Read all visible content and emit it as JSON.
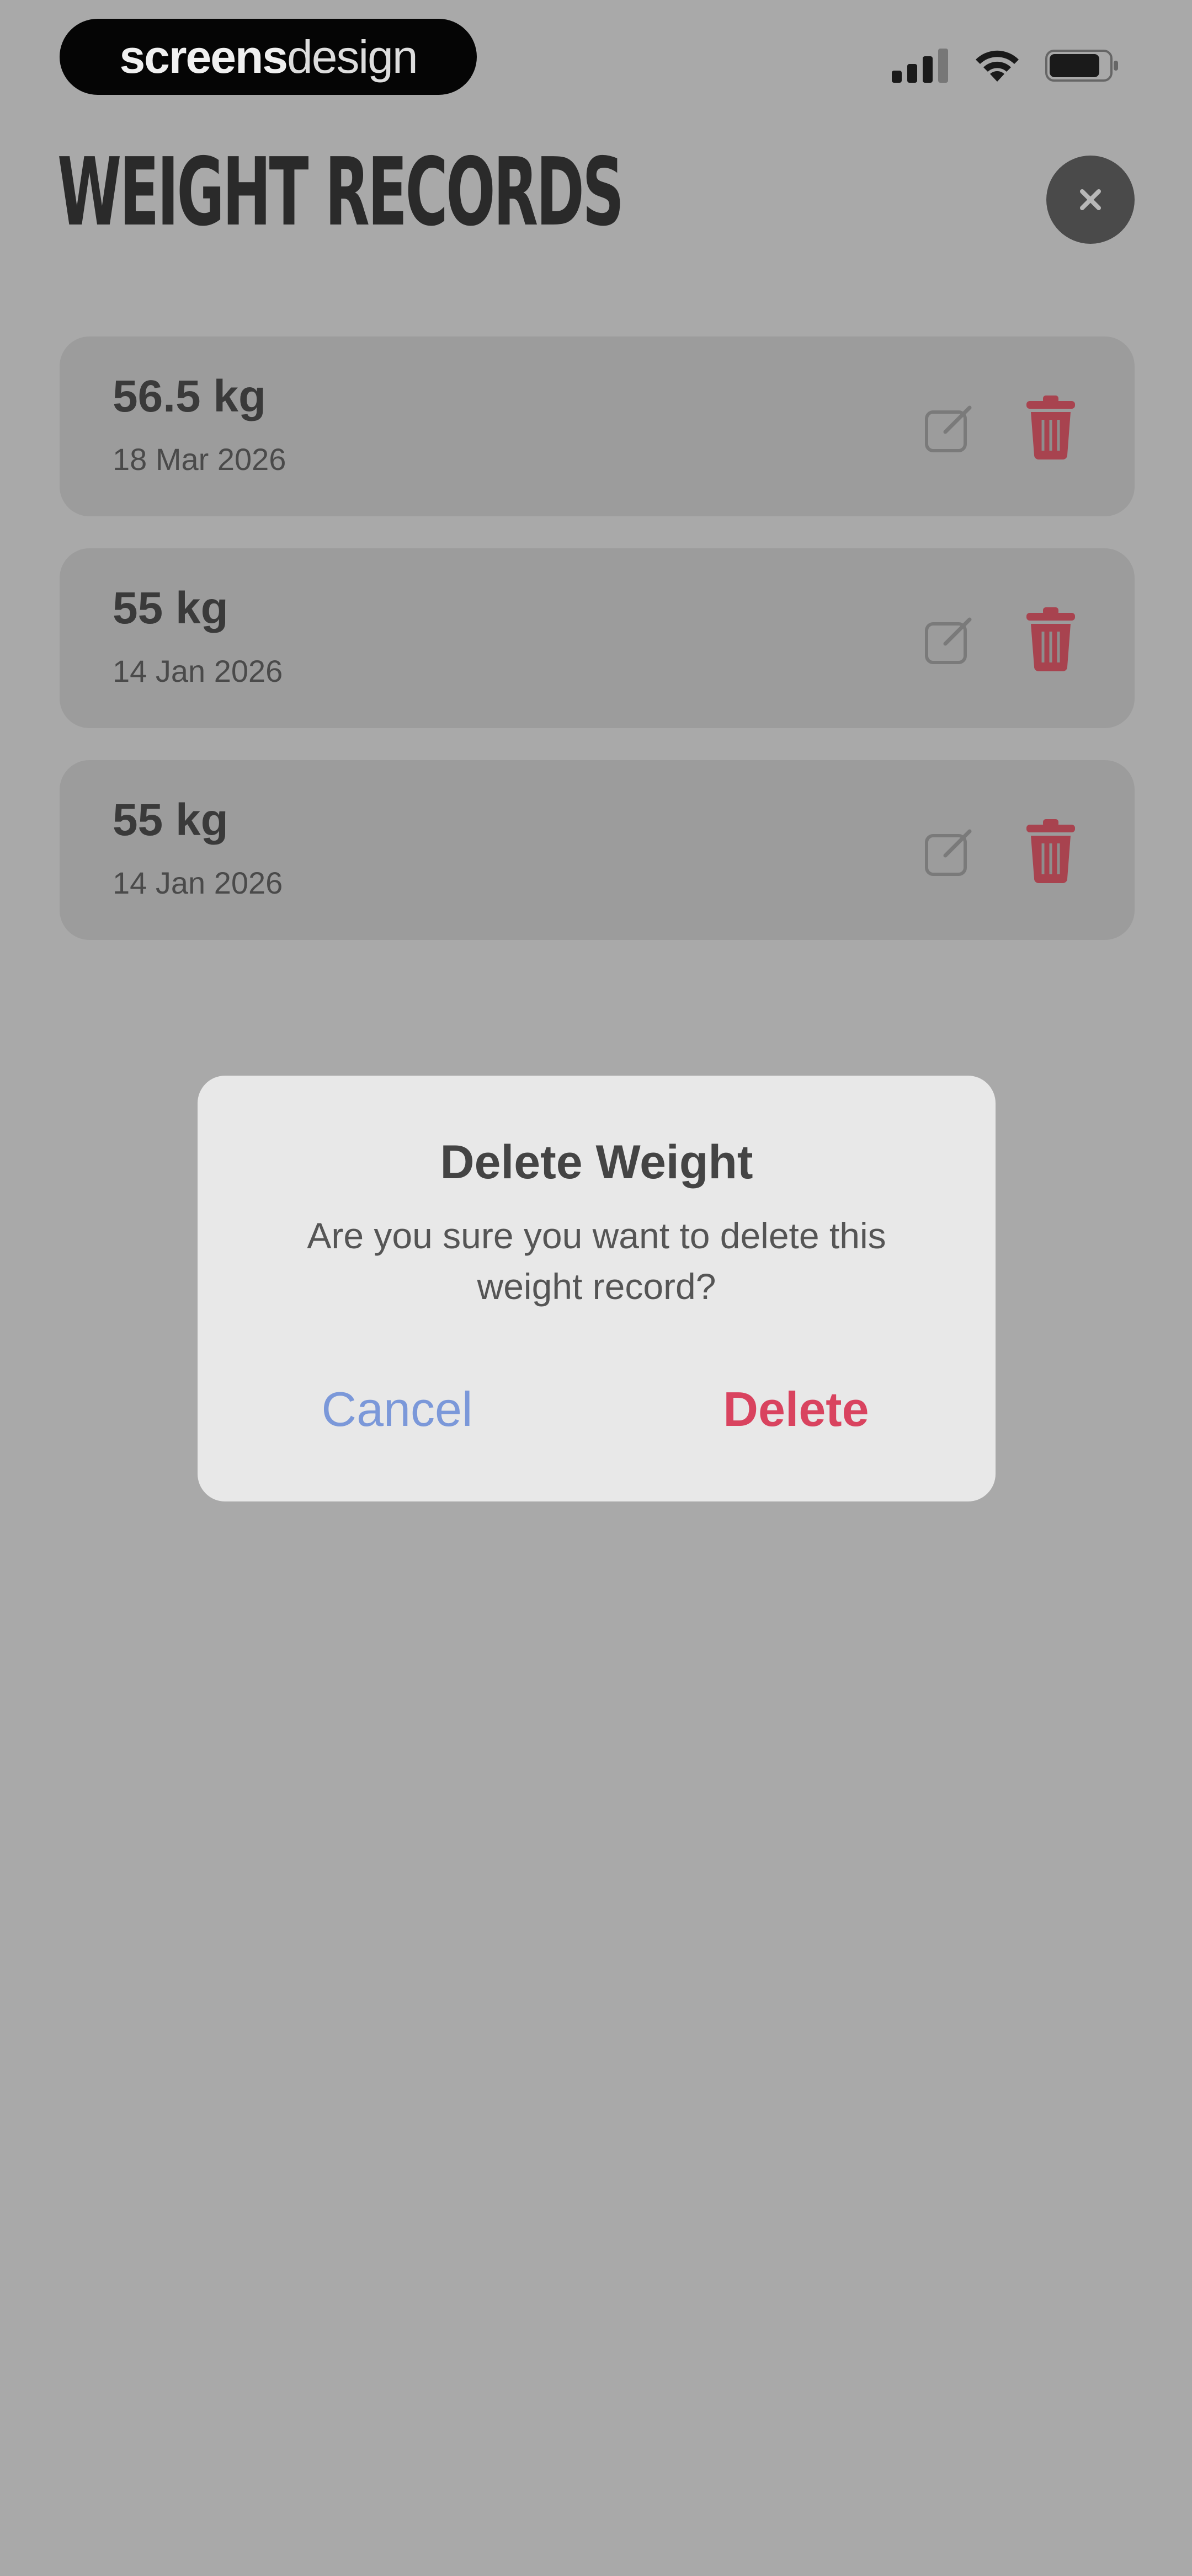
{
  "status_bar": {
    "brand_bold": "screens",
    "brand_light": "design",
    "icons": [
      "cellular-signal-icon",
      "wifi-icon",
      "battery-icon"
    ]
  },
  "header": {
    "title": "WEIGHT RECORDS",
    "close_icon": "close-icon"
  },
  "records": [
    {
      "weight": "56.5 kg",
      "date": "18 Mar 2026"
    },
    {
      "weight": "55 kg",
      "date": "14 Jan 2026"
    },
    {
      "weight": "55 kg",
      "date": "14 Jan 2026"
    }
  ],
  "dialog": {
    "title": "Delete Weight",
    "message": "Are you sure you want to delete this weight record?",
    "cancel_label": "Cancel",
    "confirm_label": "Delete"
  },
  "colors": {
    "background_dimmed": "#a9a9a9",
    "card": "#9c9c9c",
    "dialog": "#e8e8e8",
    "cancel": "#7b98d9",
    "destructive": "#d9435f",
    "trash_icon": "#a8434f"
  }
}
